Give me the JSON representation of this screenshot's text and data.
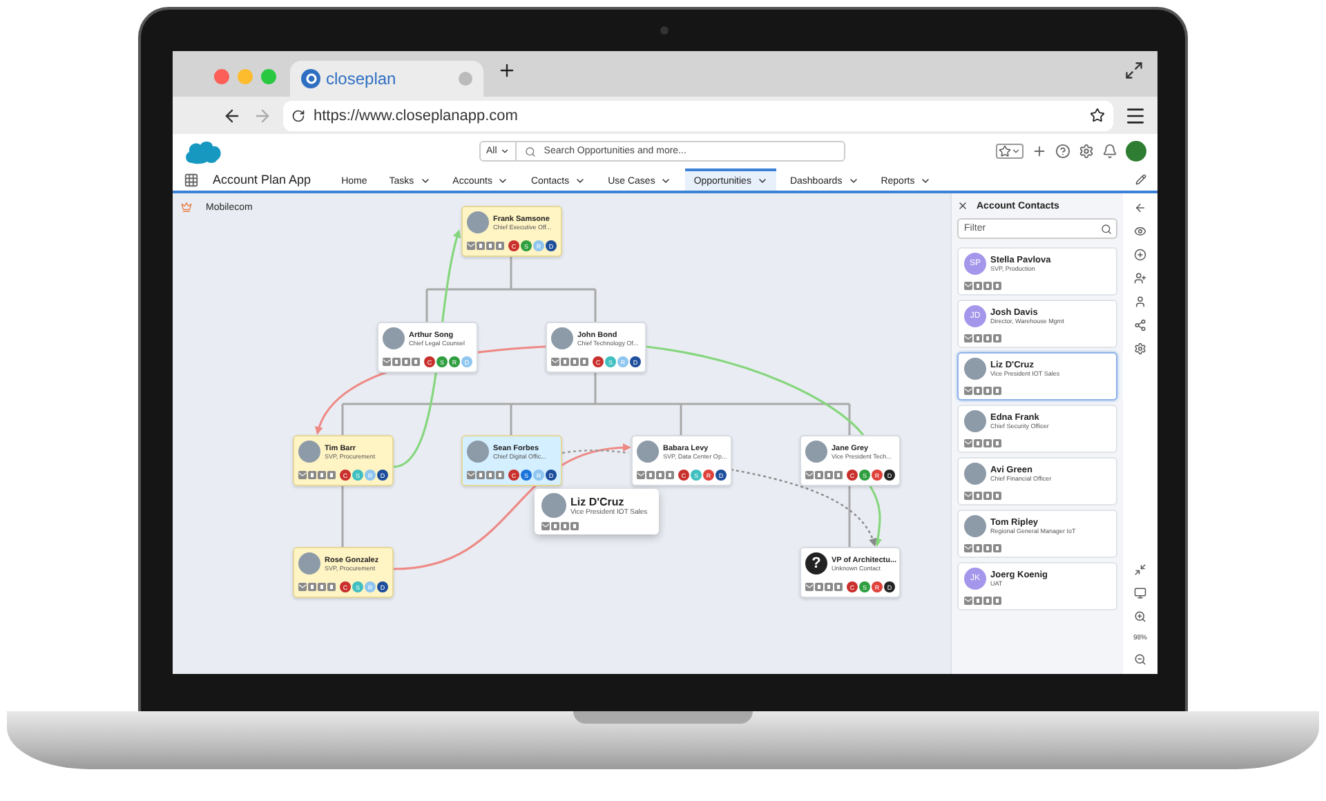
{
  "browser": {
    "tab_title": "closeplan",
    "url": "https://www.closeplanapp.com"
  },
  "header": {
    "search_scope": "All",
    "search_placeholder": "Search Opportunities and more..."
  },
  "nav": {
    "app_name": "Account Plan App",
    "items": [
      {
        "label": "Home",
        "dropdown": false,
        "selected": false
      },
      {
        "label": "Tasks",
        "dropdown": true,
        "selected": false
      },
      {
        "label": "Accounts",
        "dropdown": true,
        "selected": false
      },
      {
        "label": "Contacts",
        "dropdown": true,
        "selected": false
      },
      {
        "label": "Use Cases",
        "dropdown": true,
        "selected": false
      },
      {
        "label": "Opportunities",
        "dropdown": true,
        "selected": true
      },
      {
        "label": "Dashboards",
        "dropdown": true,
        "selected": false
      },
      {
        "label": "Reports",
        "dropdown": true,
        "selected": false
      }
    ]
  },
  "canvas": {
    "account": "Mobilecom",
    "org_chart": {
      "name": "Frank Samsone",
      "title": "Chief Executive Off...",
      "kind": "photo",
      "color": "#fff4c4",
      "badges": [
        {
          "letter": "C",
          "color": "#c9302c"
        },
        {
          "letter": "S",
          "color": "#2e9e3f"
        },
        {
          "letter": "R",
          "color": "#8ec6f0"
        },
        {
          "letter": "D",
          "color": "#1d4e9c"
        }
      ],
      "children": [
        {
          "name": "Arthur Song",
          "title": "Chief Legal Counsel",
          "kind": "photo",
          "color": "#ffffff",
          "badges": [
            {
              "letter": "C",
              "color": "#c9302c"
            },
            {
              "letter": "S",
              "color": "#2e9e3f"
            },
            {
              "letter": "R",
              "color": "#2e9e3f"
            },
            {
              "letter": "D",
              "color": "#8ec6f0"
            }
          ]
        },
        {
          "name": "John Bond",
          "title": "Chief Technology Of...",
          "kind": "photo",
          "color": "#ffffff",
          "badges": [
            {
              "letter": "C",
              "color": "#c9302c"
            },
            {
              "letter": "S",
              "color": "#3fbfbf"
            },
            {
              "letter": "R",
              "color": "#8ec6f0"
            },
            {
              "letter": "D",
              "color": "#1d4e9c"
            }
          ],
          "children": [
            {
              "name": "Tim Barr",
              "title": "SVP, Procurement",
              "kind": "photo",
              "color": "#fff4c4",
              "badges": [
                {
                  "letter": "C",
                  "color": "#c9302c"
                },
                {
                  "letter": "S",
                  "color": "#3fbfbf"
                },
                {
                  "letter": "R",
                  "color": "#8ec6f0"
                },
                {
                  "letter": "D",
                  "color": "#1d4e9c"
                }
              ],
              "children": [
                {
                  "name": "Rose Gonzalez",
                  "title": "SVP, Procurement",
                  "kind": "photo",
                  "color": "#fff4c4",
                  "badges": [
                    {
                      "letter": "C",
                      "color": "#c9302c"
                    },
                    {
                      "letter": "S",
                      "color": "#3fbfbf"
                    },
                    {
                      "letter": "R",
                      "color": "#8ec6f0"
                    },
                    {
                      "letter": "D",
                      "color": "#1d4e9c"
                    }
                  ]
                }
              ]
            },
            {
              "name": "Sean Forbes",
              "title": "Chief Digital Offic...",
              "kind": "photo",
              "color": "#d4efff",
              "badges": [
                {
                  "letter": "C",
                  "color": "#c9302c"
                },
                {
                  "letter": "S",
                  "color": "#1a73d9"
                },
                {
                  "letter": "R",
                  "color": "#8ec6f0"
                },
                {
                  "letter": "D",
                  "color": "#1d4e9c"
                }
              ]
            },
            {
              "name": "Babara Levy",
              "title": "SVP, Data Center Op...",
              "kind": "photo",
              "color": "#ffffff",
              "badges": [
                {
                  "letter": "C",
                  "color": "#c9302c"
                },
                {
                  "letter": "S",
                  "color": "#3fbfbf"
                },
                {
                  "letter": "R",
                  "color": "#e0403a"
                },
                {
                  "letter": "D",
                  "color": "#1d4e9c"
                }
              ]
            },
            {
              "name": "Jane Grey",
              "title": "Vice President Tech...",
              "kind": "photo",
              "color": "#ffffff",
              "badges": [
                {
                  "letter": "C",
                  "color": "#c9302c"
                },
                {
                  "letter": "S",
                  "color": "#2e9e3f"
                },
                {
                  "letter": "R",
                  "color": "#e0403a"
                },
                {
                  "letter": "D",
                  "color": "#222222"
                }
              ],
              "children": [
                {
                  "name": "VP of Architectu...",
                  "title": "Unknown Contact",
                  "kind": "unknown",
                  "symbol": "?",
                  "color": "#ffffff",
                  "badges": [
                    {
                      "letter": "C",
                      "color": "#c9302c"
                    },
                    {
                      "letter": "S",
                      "color": "#2e9e3f"
                    },
                    {
                      "letter": "R",
                      "color": "#e0403a"
                    },
                    {
                      "letter": "D",
                      "color": "#222222"
                    }
                  ]
                }
              ]
            }
          ]
        }
      ]
    },
    "links": [
      {
        "color": "#86d67e",
        "kind": "solid",
        "arrow": true
      },
      {
        "color": "#ee8a86",
        "kind": "solid",
        "arrow": true
      },
      {
        "color": "#86d67e",
        "kind": "solid",
        "arrow": false
      },
      {
        "color": "#86d67e",
        "kind": "solid",
        "arrow": true
      },
      {
        "color": "#ee8a86",
        "kind": "solid",
        "arrow": true
      },
      {
        "color": "#9a9a9a",
        "kind": "dotted",
        "arrow": false
      },
      {
        "color": "#8a8a8a",
        "kind": "dotted",
        "arrow": true
      }
    ],
    "drag_card": {
      "name": "Liz D'Cruz",
      "title": "Vice President IOT Sales"
    }
  },
  "contacts_panel": {
    "title": "Account Contacts",
    "filter_placeholder": "Filter",
    "contacts": [
      {
        "name": "Stella Pavlova",
        "title": "SVP, Production",
        "kind": "initials",
        "initials": "SP",
        "selected": false
      },
      {
        "name": "Josh Davis",
        "title": "Director, Warehouse Mgmt",
        "kind": "initials",
        "initials": "JD",
        "selected": false
      },
      {
        "name": "Liz D'Cruz",
        "title": "Vice President IOT Sales",
        "kind": "photo",
        "selected": true
      },
      {
        "name": "Edna Frank",
        "title": "Chief Security Officer",
        "kind": "photo",
        "selected": false
      },
      {
        "name": "Avi Green",
        "title": "Chief Financial Officer",
        "kind": "photo",
        "selected": false
      },
      {
        "name": "Tom Ripley",
        "title": "Regional General Manager IoT",
        "kind": "photo",
        "selected": false
      },
      {
        "name": "Joerg Koenig",
        "title": "UAT",
        "kind": "initials",
        "initials": "JK",
        "selected": false
      }
    ]
  },
  "rail": {
    "zoom": "98%"
  }
}
